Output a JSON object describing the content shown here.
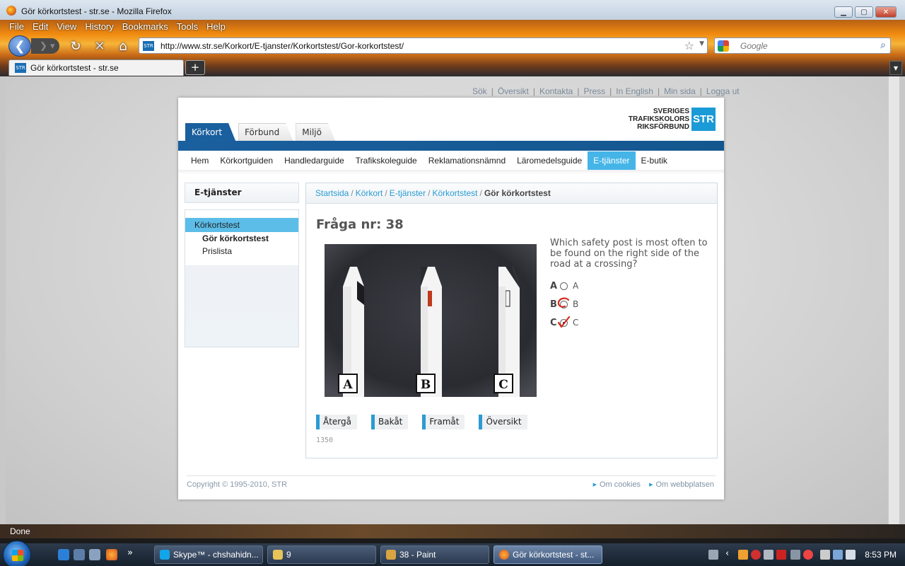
{
  "window": {
    "title": "Gör körkortstest - str.se - Mozilla Firefox"
  },
  "menu": [
    "File",
    "Edit",
    "View",
    "History",
    "Bookmarks",
    "Tools",
    "Help"
  ],
  "toolbar": {
    "url": "http://www.str.se/Korkort/E-tjanster/Korkortstest/Gor-korkortstest/",
    "search_placeholder": "Google",
    "favicon_text": "STR"
  },
  "tabs": {
    "active_label": "Gör körkortstest - str.se",
    "new_tab": "+"
  },
  "site": {
    "top_links": [
      "Sök",
      "Översikt",
      "Kontakta",
      "Press",
      "In English",
      "Min sida",
      "Logga ut"
    ],
    "logo": {
      "line1": "SVERIGES",
      "line2": "TRAFIKSKOLORS",
      "line3": "RIKSFÖRBUND",
      "badge": "STR"
    },
    "main_tabs": [
      "Körkort",
      "Förbund",
      "Miljö"
    ],
    "sub_nav": [
      "Hem",
      "Körkortguiden",
      "Handledarguide",
      "Trafikskoleguide",
      "Reklamationsnämnd",
      "Läromedelsguide",
      "E-tjänster",
      "E-butik"
    ],
    "sidebar": {
      "heading": "E-tjänster",
      "items": [
        {
          "label": "Körkortstest"
        },
        {
          "label": "Gör körkortstest"
        },
        {
          "label": "Prislista"
        }
      ]
    },
    "breadcrumb": {
      "links": [
        "Startsida",
        "Körkort",
        "E-tjänster",
        "Körkortstest"
      ],
      "current": "Gör körkortstest",
      "separator": "/"
    },
    "question": {
      "title": "Fråga nr: 38",
      "text": "Which safety post is most often to be found on the right side of the road at a crossing?",
      "image_labels": [
        "A",
        "B",
        "C"
      ],
      "answers": [
        {
          "letter": "A",
          "label": "A",
          "selected": false
        },
        {
          "letter": "B",
          "label": "B",
          "selected": false
        },
        {
          "letter": "C",
          "label": "C",
          "selected": true
        }
      ],
      "code": "1350"
    },
    "buttons": [
      "Återgå",
      "Bakåt",
      "Framåt",
      "Översikt"
    ],
    "footer": {
      "copyright": "Copyright © 1995-2010, STR",
      "links": [
        "Om cookies",
        "Om webbplatsen"
      ]
    }
  },
  "status": {
    "text": "Done"
  },
  "taskbar": {
    "tasks": [
      {
        "label": "Skype™ - chshahidn..."
      },
      {
        "label": "9"
      },
      {
        "label": "38 - Paint"
      },
      {
        "label": "Gör körkortstest - st..."
      }
    ],
    "overflow": "»",
    "clock": "8:53 PM"
  },
  "colors": {
    "accent_blue": "#1a5f9e",
    "link_blue": "#2b9bd3",
    "active_subnav": "#45b5e8",
    "mark_red": "#d42a1c"
  }
}
